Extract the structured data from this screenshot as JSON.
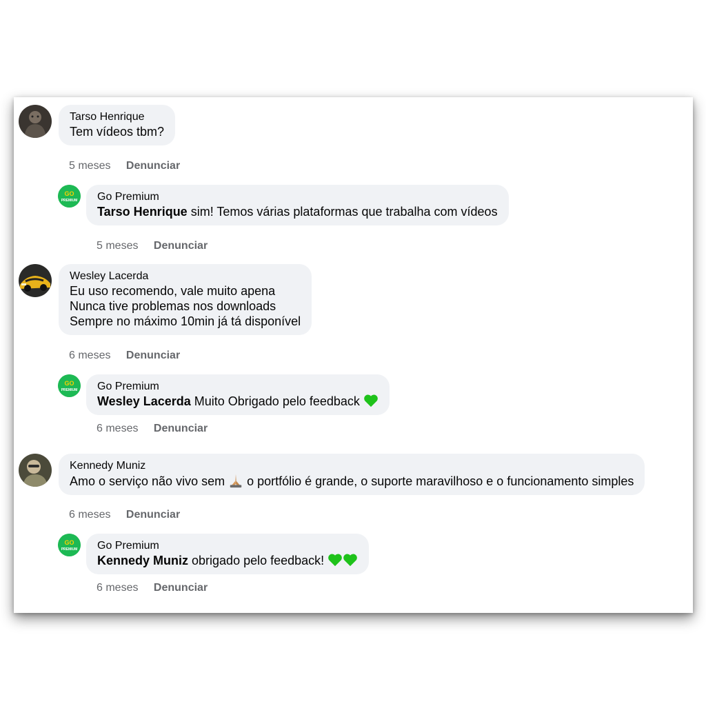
{
  "colors": {
    "bubble": "#f0f2f5",
    "meta_text": "#65676b",
    "brand_green": "#1db954",
    "heart_green": "#1ec21a"
  },
  "comments": [
    {
      "author": "Tarso Henrique",
      "text": "Tem vídeos tbm?",
      "time": "5 meses",
      "report": "Denunciar",
      "avatar_icon": "user-avatar-icon"
    },
    {
      "author": "Go Premium",
      "mention": "Tarso Henrique",
      "text": " sim! Temos várias plataformas que trabalha com vídeos",
      "time": "5 meses",
      "report": "Denunciar",
      "avatar_icon": "go-premium-logo-icon"
    },
    {
      "author": "Wesley Lacerda",
      "lines": [
        "Eu uso recomendo, vale muito apena",
        "Nunca tive problemas nos downloads",
        "Sempre no máximo 10min já tá disponível"
      ],
      "time": "6 meses",
      "report": "Denunciar",
      "avatar_icon": "car-avatar-icon"
    },
    {
      "author": "Go Premium",
      "mention": "Wesley Lacerda",
      "text": " Muito Obrigado pelo feedback ",
      "emoji": "green-heart-icon",
      "time": "6 meses",
      "report": "Denunciar",
      "avatar_icon": "go-premium-logo-icon"
    },
    {
      "author": "Kennedy Muniz",
      "text_before": "Amo o serviço não vivo sem ",
      "emoji": "praying-hands-icon",
      "text_after": " o portfólio é grande, o suporte maravilhoso e o funcionamento simples",
      "time": "6 meses",
      "report": "Denunciar",
      "avatar_icon": "user-avatar-icon"
    },
    {
      "author": "Go Premium",
      "mention": "Kennedy Muniz",
      "text": " obrigado pelo feedback! ",
      "emoji": "green-heart-icon",
      "time": "6 meses",
      "report": "Denunciar",
      "avatar_icon": "go-premium-logo-icon"
    }
  ]
}
